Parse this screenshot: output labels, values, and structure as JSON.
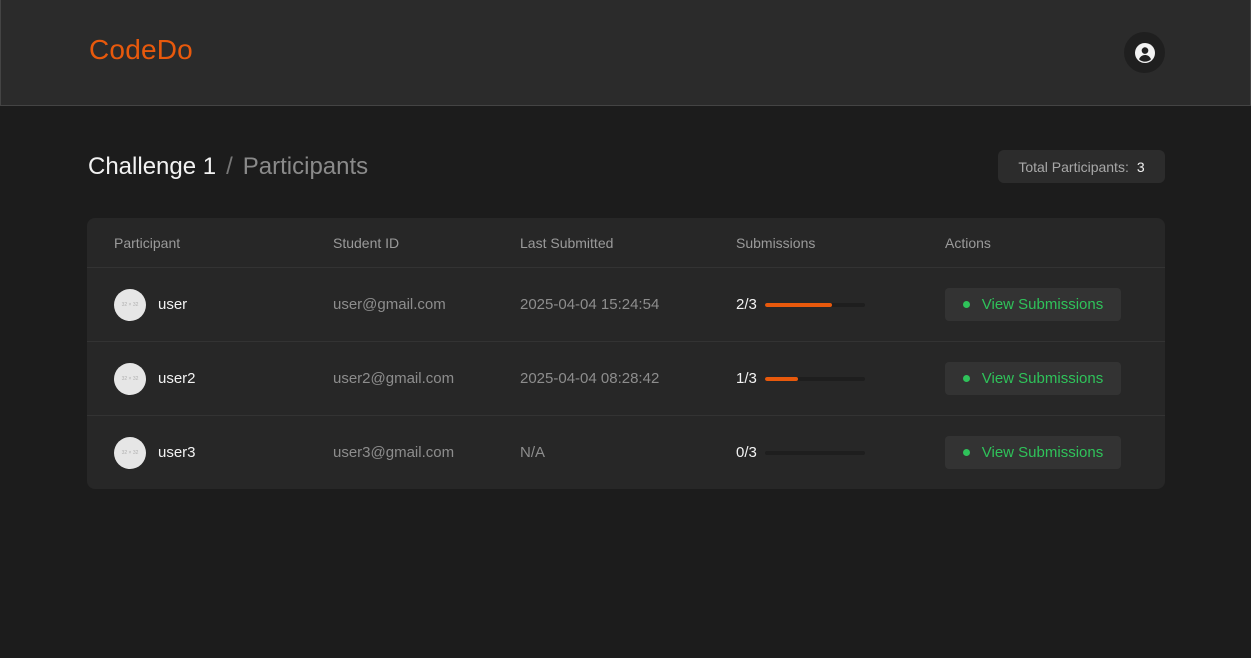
{
  "header": {
    "brand": "CodeDo",
    "profile_icon": "user-circle-icon"
  },
  "page": {
    "breadcrumb_main": "Challenge 1",
    "breadcrumb_separator": "/",
    "breadcrumb_sub": "Participants",
    "total_label": "Total Participants:",
    "total_value": "3"
  },
  "table": {
    "columns": [
      "Participant",
      "Student ID",
      "Last Submitted",
      "Submissions",
      "Actions"
    ],
    "rows": [
      {
        "avatar_text": "32 × 32",
        "name": "user",
        "student_id": "user@gmail.com",
        "last_submitted": "2025-04-04 15:24:54",
        "submissions": "2/3",
        "progress": 0.667,
        "action": "View Submissions"
      },
      {
        "avatar_text": "32 × 32",
        "name": "user2",
        "student_id": "user2@gmail.com",
        "last_submitted": "2025-04-04 08:28:42",
        "submissions": "1/3",
        "progress": 0.333,
        "action": "View Submissions"
      },
      {
        "avatar_text": "32 × 32",
        "name": "user3",
        "student_id": "user3@gmail.com",
        "last_submitted": "N/A",
        "submissions": "0/3",
        "progress": 0,
        "action": "View Submissions"
      }
    ]
  },
  "colors": {
    "accent": "#e8590c",
    "success": "#2fc25a",
    "background": "#1c1c1c"
  }
}
